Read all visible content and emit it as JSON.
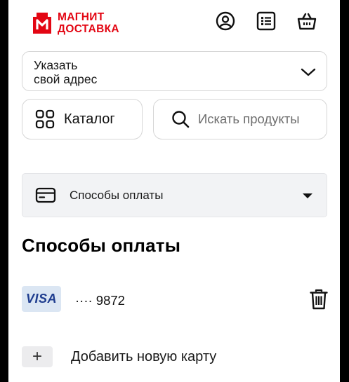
{
  "brand": {
    "line1": "МАГНИТ",
    "line2": "ДОСТАВКА",
    "color": "#e30613"
  },
  "header": {
    "icons": [
      "profile-icon",
      "orders-list-icon",
      "cart-icon"
    ]
  },
  "address": {
    "line1": "Указать",
    "line2": "свой адрес"
  },
  "catalog": {
    "label": "Каталог"
  },
  "search": {
    "placeholder": "Искать продукты"
  },
  "section_select": {
    "label": "Способы оплаты"
  },
  "page": {
    "title": "Способы оплаты"
  },
  "cards": [
    {
      "brand": "VISA",
      "number": "···· 9872"
    }
  ],
  "add_card": {
    "plus": "+",
    "label": "Добавить новую карту"
  }
}
